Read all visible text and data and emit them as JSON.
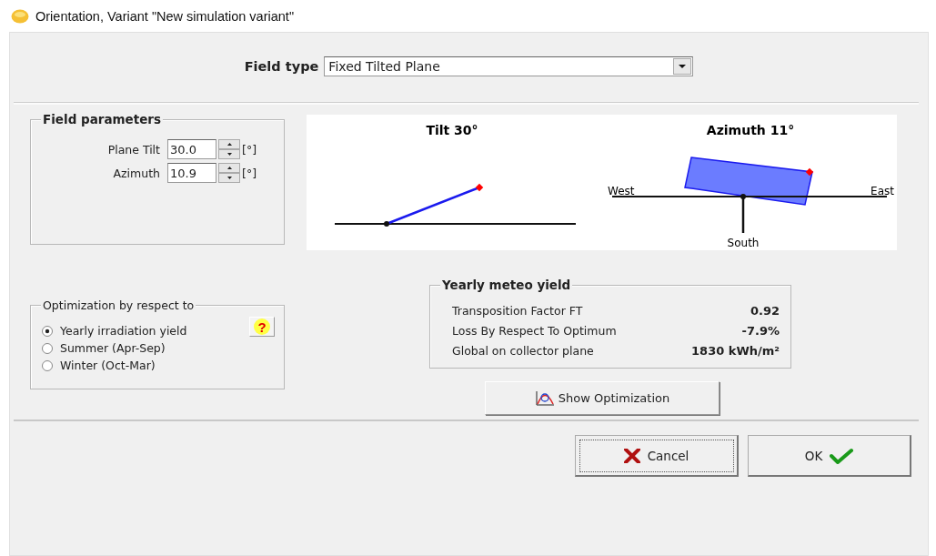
{
  "window": {
    "title": "Orientation, Variant \"New simulation variant\""
  },
  "field_type": {
    "label": "Field type",
    "value": "Fixed Tilted Plane"
  },
  "field_parameters": {
    "title": "Field parameters",
    "params": [
      {
        "label": "Plane Tilt",
        "value": "30.0",
        "unit": "[°]"
      },
      {
        "label": "Azimuth",
        "value": "10.9",
        "unit": "[°]"
      }
    ]
  },
  "diagram": {
    "tilt_title": "Tilt 30°",
    "azimuth_title": "Azimuth 11°",
    "west": "West",
    "east": "East",
    "south": "South"
  },
  "optimization": {
    "title": "Optimization by respect to",
    "help": "?",
    "options": [
      {
        "label": "Yearly irradiation yield",
        "selected": true
      },
      {
        "label": "Summer (Apr-Sep)",
        "selected": false
      },
      {
        "label": "Winter (Oct-Mar)",
        "selected": false
      }
    ]
  },
  "yearly_yield": {
    "title": "Yearly meteo yield",
    "rows": [
      {
        "label": "Transposition Factor FT",
        "value": "0.92"
      },
      {
        "label": "Loss By Respect To Optimum",
        "value": "-7.9%"
      },
      {
        "label": "Global on collector plane",
        "value": "1830 kWh/m²"
      }
    ]
  },
  "show_optimization": "Show Optimization",
  "buttons": {
    "cancel": "Cancel",
    "ok": "OK"
  }
}
